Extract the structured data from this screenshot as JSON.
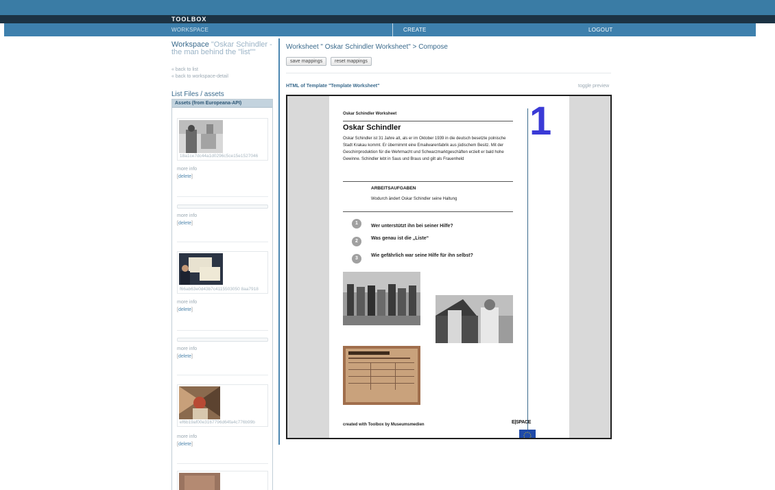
{
  "header": {
    "brand": "TOOLBOX",
    "nav": [
      {
        "label": "WORKSPACE",
        "active": true
      },
      {
        "label": "CREATE"
      },
      {
        "label": "LOGOUT"
      }
    ]
  },
  "workspace": {
    "prefix": "Workspace",
    "name": "\"Oskar Schindler - the man behind the \"list\"\"",
    "back_to_list": "« back to list",
    "back_to_detail": "« back to workspace-detail",
    "files_title": "List Files / assets",
    "assets_header": "Assets (from Europeana-API)",
    "assets": [
      {
        "hash": "18a1ce7dc44a1d0296c5ce15e1527046",
        "more": "more info",
        "delete": "delete",
        "has_thumb": true
      },
      {
        "hash": "",
        "more": "more info",
        "delete": "delete",
        "has_thumb": false
      },
      {
        "hash": "f66ab63e0d43b7c4115503050 8aa7918",
        "more": "more info",
        "delete": "delete",
        "has_thumb": true
      },
      {
        "hash": "",
        "more": "more info",
        "delete": "delete",
        "has_thumb": false
      },
      {
        "hash": "ef6b19af00e3167796d64fa4c776b99b",
        "more": "more info",
        "delete": "delete",
        "has_thumb": true
      }
    ]
  },
  "compose": {
    "heading": "Worksheet \" Oskar Schindler Worksheet\" > Compose",
    "save_mappings": "save mappings",
    "reset_mappings": "reset mappings",
    "template_heading": "HTML of Template \"Template Worksheet\"",
    "toggle_preview": "toggle preview"
  },
  "worksheet": {
    "small_title": "Oskar Schindler Worksheet",
    "title": "Oskar Schindler",
    "number": "1",
    "body": "Oskar Schindler ist 31 Jahre alt, als er im Oktober 1939 in die deutsch besetzte polnische Stadt Krakau kommt. Er übernimmt eine Emailwarenfabrik aus jüdischem Besitz. Mit der Geschirrproduktion für die Wehrmacht und Schwarzmarktgeschäften erzielt er bald hohe Gewinne. Schindler lebt in Saus und Braus und gilt als Frauenheld",
    "task_heading": "ARBEITSAUFGABEN",
    "task_sub": "Wodurch ändert Oskar Schindler seine Haltung",
    "questions": [
      {
        "n": "1",
        "text": "Wer unterstützt ihn bei seiner Hilfe?"
      },
      {
        "n": "2",
        "text": "Was genau ist die „Liste“"
      },
      {
        "n": "3",
        "text": "Wie gefährlich war seine Hilfe für ihn selbst?"
      }
    ],
    "footer": "created with Toolbox by Museumsmedien",
    "logo": "E|SPACE"
  },
  "colors": {
    "nav_bar": "#3e80ad",
    "dark_bar": "#1c3344",
    "link_blue": "#3a6a8c",
    "big_number": "#3a3ad6"
  }
}
